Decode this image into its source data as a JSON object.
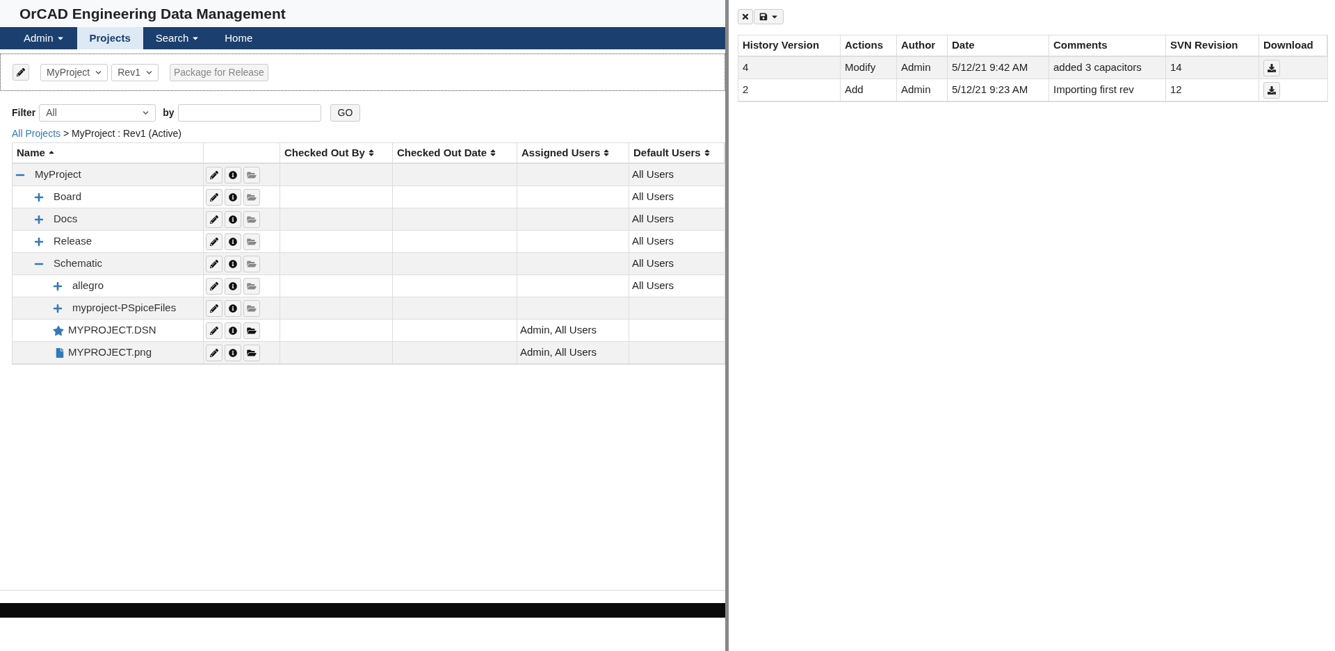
{
  "app_title": "OrCAD Engineering Data Management",
  "nav": [
    {
      "label": "Admin",
      "dropdown": true,
      "selected": false
    },
    {
      "label": "Projects",
      "dropdown": false,
      "selected": true
    },
    {
      "label": "Search",
      "dropdown": true,
      "selected": false
    },
    {
      "label": "Home",
      "dropdown": false,
      "selected": false
    }
  ],
  "toolbar": {
    "project": "MyProject",
    "revision": "Rev1",
    "package_button": {
      "label": "Package for Release",
      "disabled": true
    }
  },
  "filter": {
    "label": "Filter",
    "value": "All",
    "by_label": "by",
    "go": "GO"
  },
  "breadcrumb": {
    "link": "All Projects",
    "rest": "> MyProject : Rev1 (Active)"
  },
  "tree_table": {
    "columns": [
      {
        "label": "Name",
        "sorted": true
      },
      {
        "sortable": false
      },
      {
        "label": "Checked Out By",
        "sorted": false
      },
      {
        "label": "Checked Out Date",
        "sorted": false
      },
      {
        "label": "Assigned Users",
        "sorted": false
      },
      {
        "label": "Default Users",
        "sorted": false
      }
    ],
    "rows": [
      {
        "name": "MyProject",
        "kind": "folder",
        "expanded": true,
        "default_users": "All Users",
        "children": [
          {
            "name": "Board",
            "kind": "folder",
            "expanded": false,
            "default_users": "All Users"
          },
          {
            "name": "Docs",
            "kind": "folder",
            "expanded": false,
            "default_users": "All Users"
          },
          {
            "name": "Release",
            "kind": "folder",
            "expanded": false,
            "default_users": "All Users"
          },
          {
            "name": "Schematic",
            "kind": "folder",
            "expanded": true,
            "default_users": "All Users",
            "children": [
              {
                "name": "allegro",
                "kind": "folder",
                "expanded": false,
                "default_users": "All Users"
              },
              {
                "name": "myproject-PSpiceFiles",
                "kind": "folder",
                "expanded": false
              },
              {
                "name": "MYPROJECT.DSN",
                "kind": "design",
                "assigned_users": "Admin, All Users"
              },
              {
                "name": "MYPROJECT.png",
                "kind": "file",
                "assigned_users": "Admin, All Users"
              }
            ]
          }
        ]
      }
    ]
  },
  "history_table": {
    "columns": [
      "History Version",
      "Actions",
      "Author",
      "Date",
      "Comments",
      "SVN Revision",
      "Download"
    ],
    "rows": [
      {
        "version": "4",
        "action": "Modify",
        "author": "Admin",
        "date": "5/12/21 9:42 AM",
        "comment": "added 3 capacitors",
        "svn": "14"
      },
      {
        "version": "2",
        "action": "Add",
        "author": "Admin",
        "date": "5/12/21 9:23 AM",
        "comment": "Importing first rev",
        "svn": "12"
      }
    ]
  }
}
